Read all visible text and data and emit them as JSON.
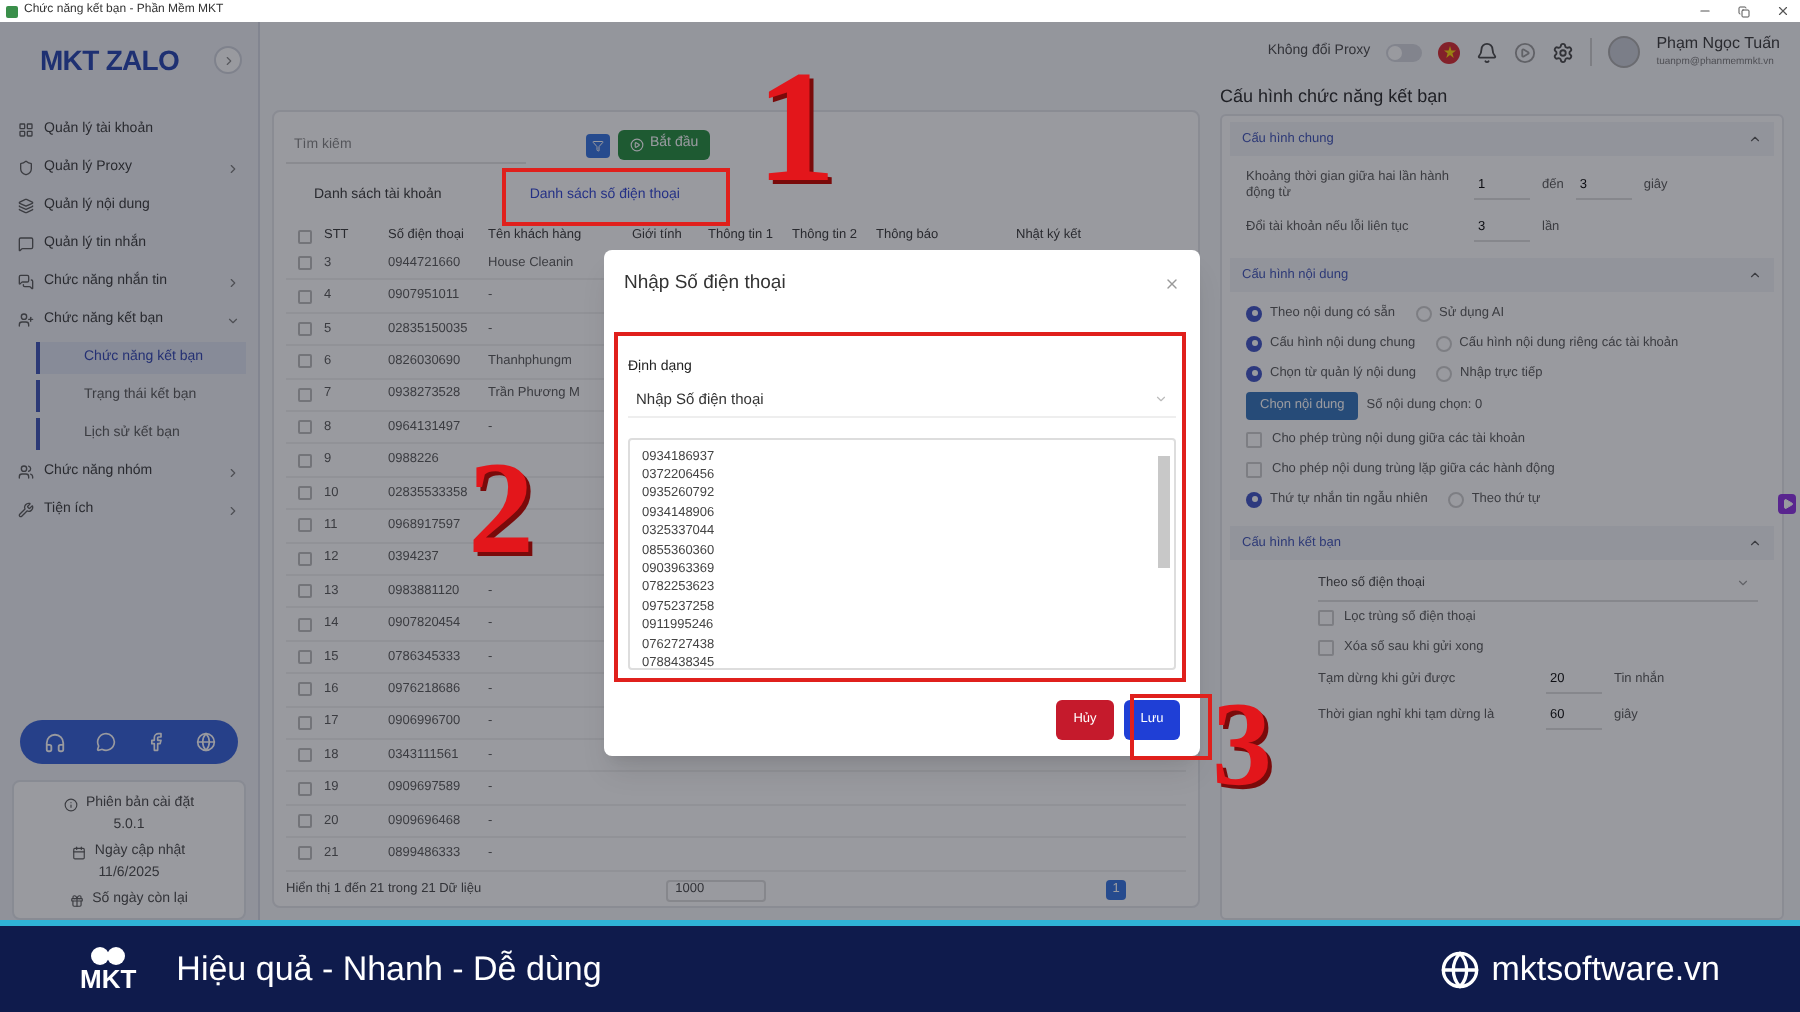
{
  "window": {
    "title": "Chức năng kết bạn - Phần Mềm MKT"
  },
  "sidebar": {
    "logo": "MKT ZALO",
    "items": [
      {
        "label": "Quản lý tài khoản"
      },
      {
        "label": "Quản lý Proxy",
        "expanded": false
      },
      {
        "label": "Quản lý nội dung"
      },
      {
        "label": "Quản lý tin nhắn"
      },
      {
        "label": "Chức năng nhắn tin",
        "expanded": false
      },
      {
        "label": "Chức năng kết bạn",
        "expanded": true,
        "children": [
          {
            "label": "Chức năng kết bạn",
            "selected": true
          },
          {
            "label": "Trạng thái kết bạn",
            "selected": false
          },
          {
            "label": "Lịch sử kết bạn",
            "selected": false
          }
        ]
      },
      {
        "label": "Chức năng nhóm",
        "expanded": false
      },
      {
        "label": "Tiện ích",
        "expanded": false
      }
    ],
    "info": [
      {
        "label": "Phiên bản cài đặt",
        "value": "5.0.1"
      },
      {
        "label": "Ngày cập nhật",
        "value": "11/6/2025"
      },
      {
        "label": "Số ngày còn lại"
      }
    ]
  },
  "header": {
    "proxy_label": "Không đổi Proxy",
    "proxy_on": false,
    "user_name": "Phạm Ngọc Tuấn",
    "user_email": "tuanpm@phanmemmkt.vn"
  },
  "toolbar": {
    "search_placeholder": "Tìm kiếm",
    "start_button": "Bắt đầu"
  },
  "tabs": [
    {
      "label": "Danh sách tài khoản",
      "selected": false
    },
    {
      "label": "Danh sách số điện thoại",
      "selected": true
    }
  ],
  "table": {
    "columns": [
      "STT",
      "Số điện thoại",
      "Tên khách hàng",
      "Giới tính",
      "Thông tin 1",
      "Thông tin 2",
      "Thông báo",
      "Nhật ký kết"
    ],
    "all_checked": false,
    "rows": [
      {
        "stt": "3",
        "phone": "0944721660",
        "name": "House Cleanin",
        "checked": false
      },
      {
        "stt": "4",
        "phone": "0907951011",
        "name": "-",
        "checked": false
      },
      {
        "stt": "5",
        "phone": "02835150035",
        "name": "-",
        "checked": false
      },
      {
        "stt": "6",
        "phone": "0826030690",
        "name": "Thanhphungm",
        "checked": false
      },
      {
        "stt": "7",
        "phone": "0938273528",
        "name": "Trần Phương M",
        "checked": false
      },
      {
        "stt": "8",
        "phone": "0964131497",
        "name": "-",
        "checked": false
      },
      {
        "stt": "9",
        "phone": "0988226",
        "checked": false
      },
      {
        "stt": "10",
        "phone": "02835533358",
        "checked": false
      },
      {
        "stt": "11",
        "phone": "0968917597",
        "checked": false
      },
      {
        "stt": "12",
        "phone": "0394237",
        "checked": false
      },
      {
        "stt": "13",
        "phone": "0983881120",
        "name": "-",
        "checked": false
      },
      {
        "stt": "14",
        "phone": "0907820454",
        "name": "-",
        "checked": false
      },
      {
        "stt": "15",
        "phone": "0786345333",
        "name": "-",
        "checked": false
      },
      {
        "stt": "16",
        "phone": "0976218686",
        "name": "-",
        "checked": false
      },
      {
        "stt": "17",
        "phone": "0906996700",
        "name": "-",
        "checked": false
      },
      {
        "stt": "18",
        "phone": "0343111561",
        "name": "-",
        "checked": false
      },
      {
        "stt": "19",
        "phone": "0909697589",
        "name": "-",
        "checked": false
      },
      {
        "stt": "20",
        "phone": "0909696468",
        "name": "-",
        "checked": false
      },
      {
        "stt": "21",
        "phone": "0899486333",
        "name": "-",
        "checked": false
      }
    ],
    "footer": "Hiển thị 1 đến 21 trong 21 Dữ liệu",
    "page_size": "1000",
    "page": "1"
  },
  "config": {
    "title": "Cấu hình chức năng kết bạn",
    "sections": [
      {
        "title": "Cấu hình chung",
        "expanded": true,
        "rows": [
          {
            "kind": "range",
            "label": "Khoảng thời gian giữa hai lần hành động từ",
            "from": "1",
            "between": "đến",
            "to": "3",
            "unit": "giây"
          },
          {
            "kind": "number",
            "label": "Đổi tài khoản nếu lỗi liên tục",
            "value": "3",
            "unit": "lần"
          }
        ]
      },
      {
        "title": "Cấu hình nội dung",
        "expanded": true,
        "rows": [
          {
            "kind": "radio",
            "options": [
              {
                "label": "Theo nội dung có sẵn",
                "selected": true
              },
              {
                "label": "Sử dụng AI",
                "selected": false
              }
            ]
          },
          {
            "kind": "radio",
            "options": [
              {
                "label": "Cấu hình nội dung chung",
                "selected": true
              },
              {
                "label": "Cấu hình nội dung riêng các tài khoản",
                "selected": false
              }
            ]
          },
          {
            "kind": "radio",
            "options": [
              {
                "label": "Chọn từ quản lý nội dung",
                "selected": true
              },
              {
                "label": "Nhập trực tiếp",
                "selected": false
              }
            ]
          },
          {
            "kind": "button",
            "label": "Chọn nội dung",
            "note": "Số nội dung chọn: 0"
          },
          {
            "kind": "checkbox",
            "label": "Cho phép trùng nội dung giữa các tài khoản",
            "checked": false
          },
          {
            "kind": "checkbox",
            "label": "Cho phép nội dung trùng lặp giữa các hành động",
            "checked": false
          },
          {
            "kind": "radio",
            "options": [
              {
                "label": "Thứ tự nhắn tin ngẫu nhiên",
                "selected": true
              },
              {
                "label": "Theo thứ tự",
                "selected": false
              }
            ]
          }
        ]
      },
      {
        "title": "Cấu hình kết bạn",
        "expanded": true,
        "rows": [
          {
            "kind": "select",
            "value": "Theo số điện thoại"
          },
          {
            "kind": "checkbox",
            "label": "Lọc trùng số điện thoại",
            "checked": false
          },
          {
            "kind": "checkbox",
            "label": "Xóa số sau khi gửi xong",
            "checked": false
          },
          {
            "kind": "number",
            "label": "Tạm dừng khi gửi được",
            "value": "20",
            "unit": "Tin nhắn"
          },
          {
            "kind": "number",
            "label": "Thời gian nghỉ khi tạm dừng là",
            "value": "60",
            "unit": "giây"
          }
        ]
      }
    ]
  },
  "dialog": {
    "title": "Nhập Số điện thoại",
    "format_label": "Định dạng",
    "format_value": "Nhập Số điện thoại",
    "phones": [
      "0934186937",
      "0372206456",
      "0935260792",
      "0934148906",
      "0325337044",
      "0855360360",
      "0903963369",
      "0782253623",
      "0975237258",
      "0911995246",
      "0762727438",
      "0788438345"
    ],
    "cancel": "Hủy",
    "save": "Lưu"
  },
  "annotations": [
    "1",
    "2",
    "3"
  ],
  "banner": {
    "logo": "MKT",
    "slogan": "Hiệu quả - Nhanh - Dễ dùng",
    "website": "mktsoftware.vn"
  }
}
